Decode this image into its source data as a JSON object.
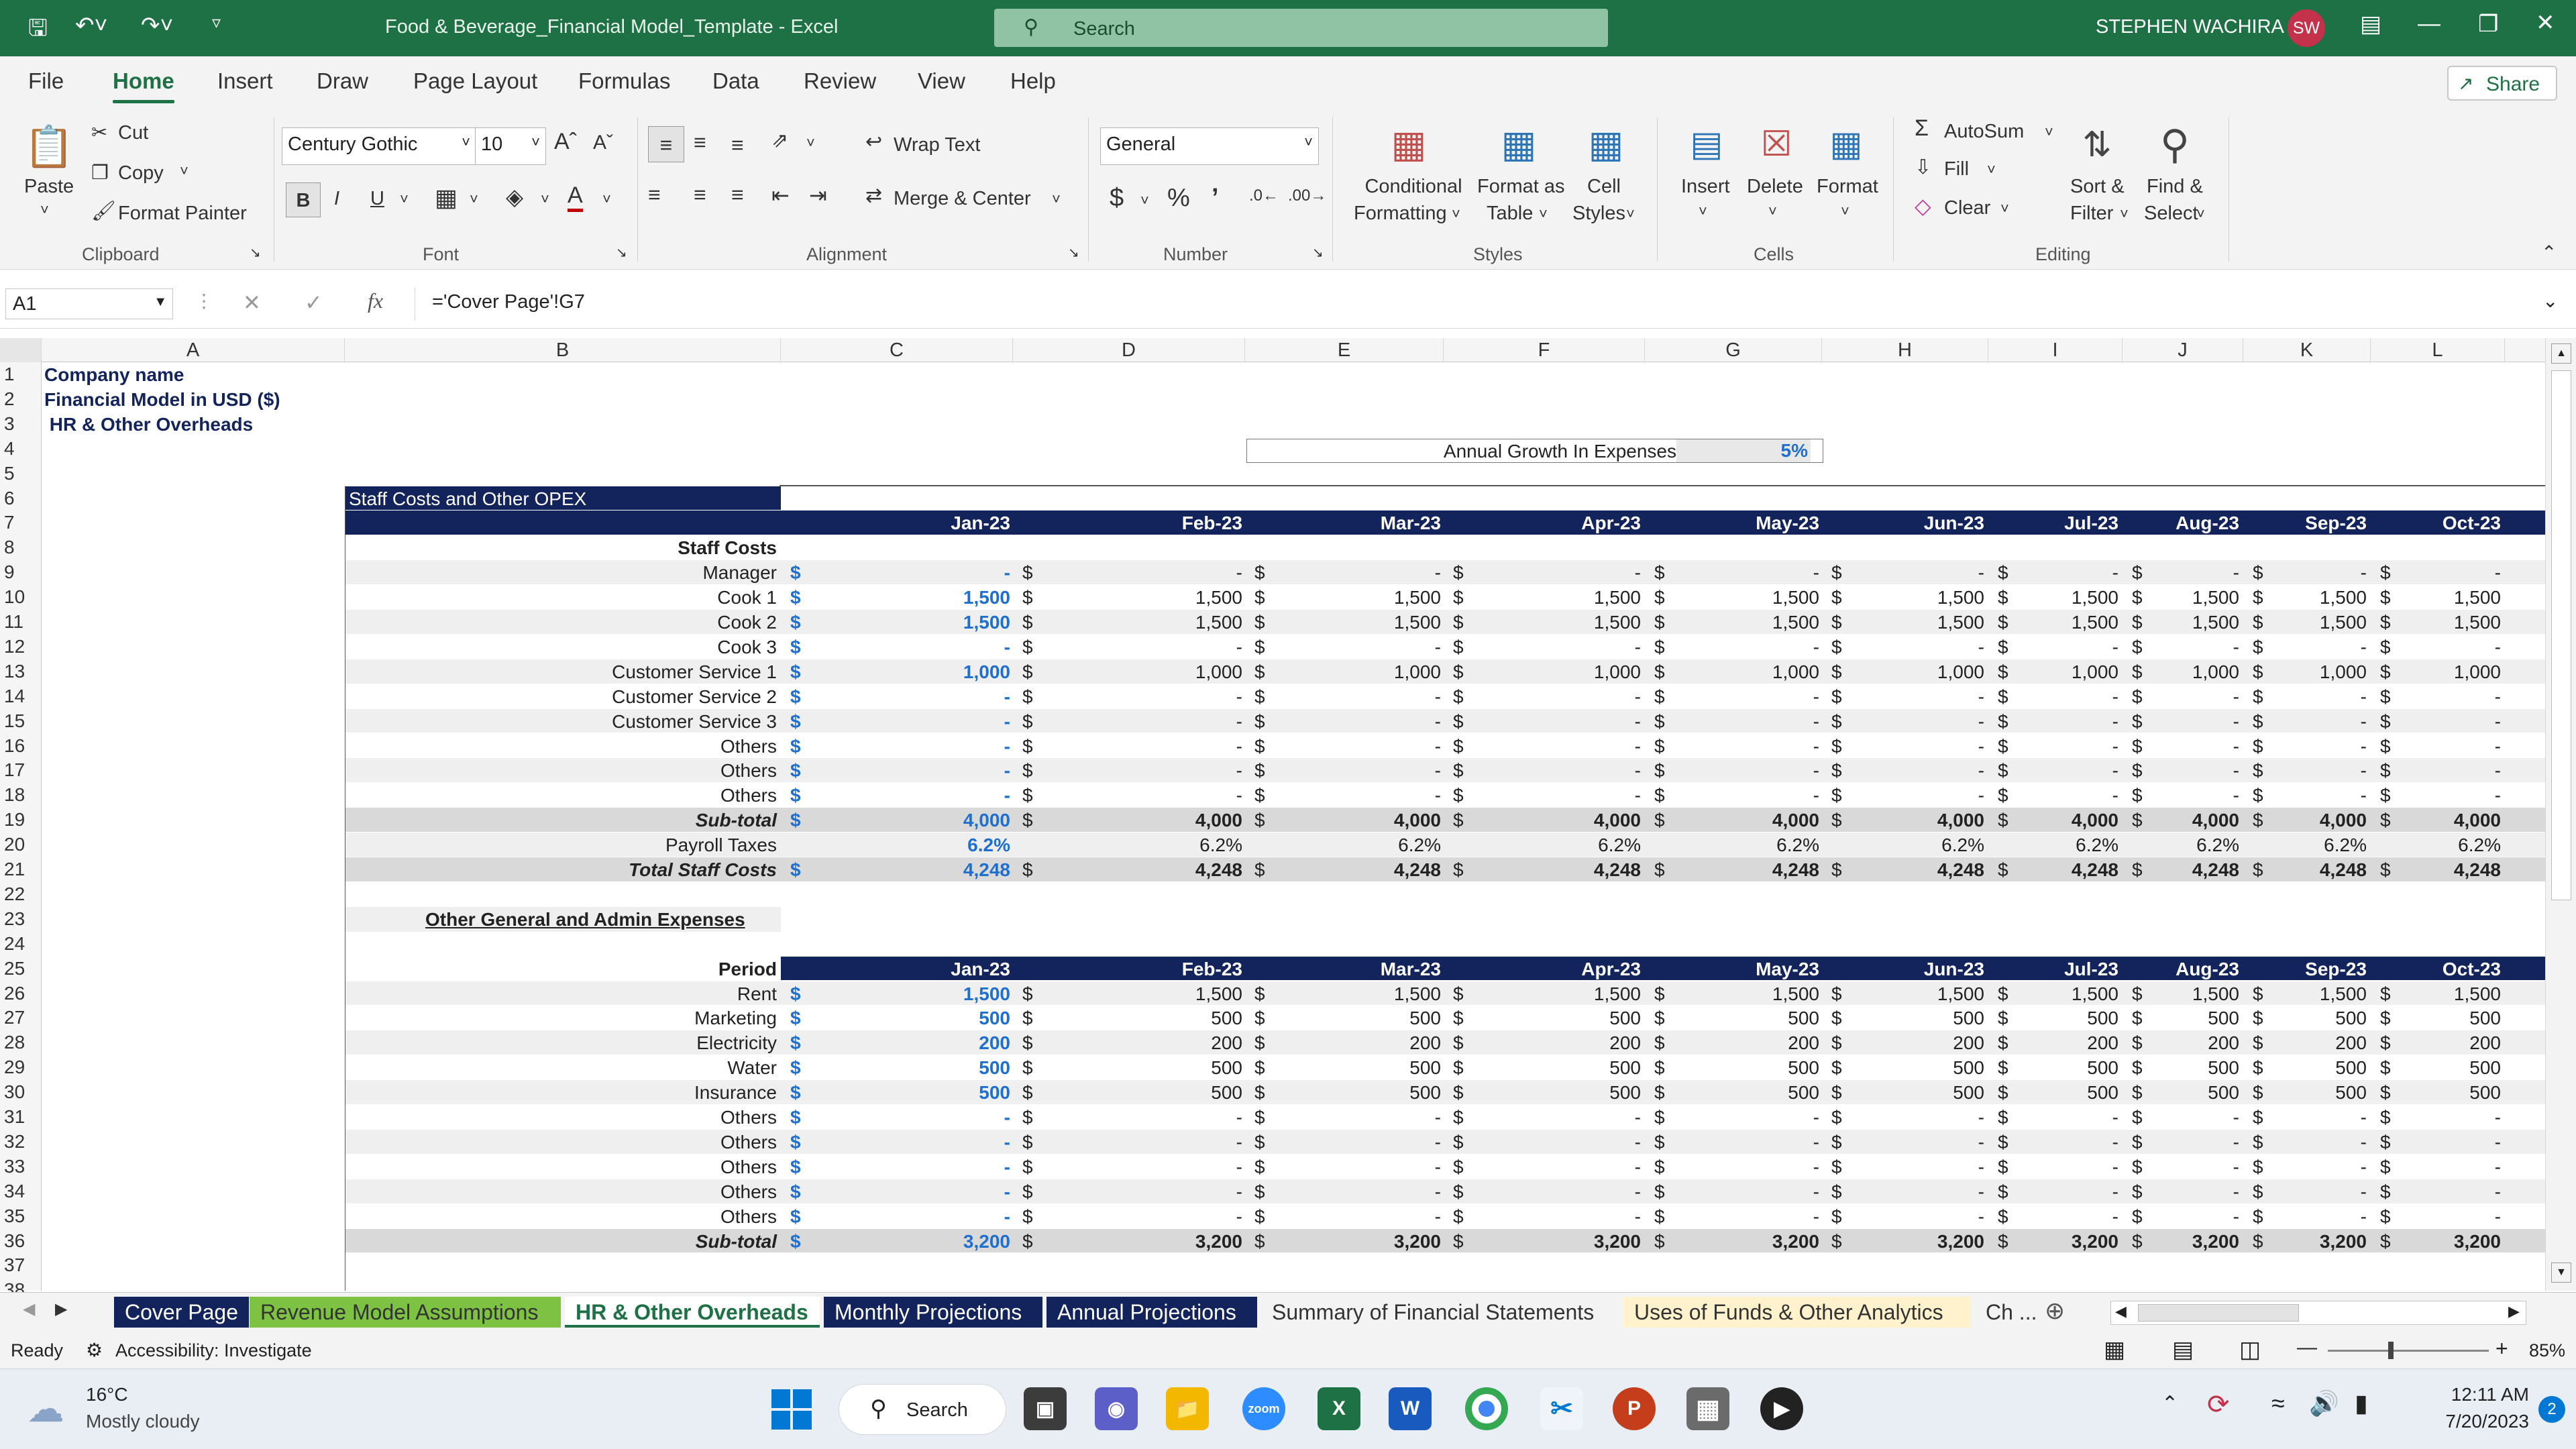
{
  "titlebar": {
    "doc_title": "Food & Beverage_Financial Model_Template  -  Excel",
    "search_placeholder": "Search",
    "user_name": "STEPHEN WACHIRA",
    "user_initials": "SW"
  },
  "menu": {
    "tabs": [
      "File",
      "Home",
      "Insert",
      "Draw",
      "Page Layout",
      "Formulas",
      "Data",
      "Review",
      "View",
      "Help"
    ],
    "active": "Home",
    "share": "Share"
  },
  "ribbon": {
    "paste": "Paste",
    "cut": "Cut",
    "copy": "Copy",
    "format_painter": "Format Painter",
    "clipboard": "Clipboard",
    "font_name": "Century Gothic",
    "font_size": "10",
    "font": "Font",
    "wrap_text": "Wrap Text",
    "merge_center": "Merge & Center",
    "alignment": "Alignment",
    "number_format": "General",
    "number": "Number",
    "conditional_formatting": [
      "Conditional",
      "Formatting"
    ],
    "format_as_table": [
      "Format as",
      "Table"
    ],
    "cell_styles": [
      "Cell",
      "Styles"
    ],
    "styles": "Styles",
    "insert": "Insert",
    "delete": "Delete",
    "format": "Format",
    "cells": "Cells",
    "autosum": "AutoSum",
    "fill": "Fill",
    "clear": "Clear",
    "sort_filter": [
      "Sort &",
      "Filter"
    ],
    "find_select": [
      "Find &",
      "Select"
    ],
    "editing": "Editing"
  },
  "formula_bar": {
    "name_box": "A1",
    "formula": "='Cover Page'!G7",
    "fx": "fx"
  },
  "columns": [
    "A",
    "B",
    "C",
    "D",
    "E",
    "F",
    "G",
    "H",
    "I",
    "J",
    "K",
    "L"
  ],
  "rows": [
    "1",
    "2",
    "3",
    "4",
    "5",
    "6",
    "7",
    "8",
    "9",
    "10",
    "11",
    "12",
    "13",
    "14",
    "15",
    "16",
    "17",
    "18",
    "19",
    "20",
    "21",
    "22",
    "23",
    "24",
    "25",
    "26",
    "27",
    "28",
    "29",
    "30",
    "31",
    "32",
    "33",
    "34",
    "35",
    "36",
    "37",
    "38"
  ],
  "sheet": {
    "company": "Company name",
    "model": "Financial  Model in USD ($)",
    "section": " HR & Other Overheads",
    "growth_label": "Annual Growth In Expenses",
    "growth_value": "5%",
    "staff_header": "Staff Costs and Other OPEX",
    "staff_costs": "Staff Costs",
    "other_header": "Other General and Admin Expenses",
    "period": "Period",
    "months": [
      "Jan-23",
      "Feb-23",
      "Mar-23",
      "Apr-23",
      "May-23",
      "Jun-23",
      "Jul-23",
      "Aug-23",
      "Sep-23",
      "Oct-23"
    ],
    "staff_rows": [
      {
        "label": "Manager",
        "values": [
          "-",
          "-",
          "-",
          "-",
          "-",
          "-",
          "-",
          "-",
          "-",
          "-"
        ]
      },
      {
        "label": "Cook 1",
        "values": [
          "1,500",
          "1,500",
          "1,500",
          "1,500",
          "1,500",
          "1,500",
          "1,500",
          "1,500",
          "1,500",
          "1,500"
        ]
      },
      {
        "label": "Cook 2",
        "values": [
          "1,500",
          "1,500",
          "1,500",
          "1,500",
          "1,500",
          "1,500",
          "1,500",
          "1,500",
          "1,500",
          "1,500"
        ]
      },
      {
        "label": "Cook 3",
        "values": [
          "-",
          "-",
          "-",
          "-",
          "-",
          "-",
          "-",
          "-",
          "-",
          "-"
        ]
      },
      {
        "label": "Customer Service 1",
        "values": [
          "1,000",
          "1,000",
          "1,000",
          "1,000",
          "1,000",
          "1,000",
          "1,000",
          "1,000",
          "1,000",
          "1,000"
        ]
      },
      {
        "label": "Customer Service 2",
        "values": [
          "-",
          "-",
          "-",
          "-",
          "-",
          "-",
          "-",
          "-",
          "-",
          "-"
        ]
      },
      {
        "label": "Customer Service 3",
        "values": [
          "-",
          "-",
          "-",
          "-",
          "-",
          "-",
          "-",
          "-",
          "-",
          "-"
        ]
      },
      {
        "label": "Others",
        "values": [
          "-",
          "-",
          "-",
          "-",
          "-",
          "-",
          "-",
          "-",
          "-",
          "-"
        ]
      },
      {
        "label": "Others",
        "values": [
          "-",
          "-",
          "-",
          "-",
          "-",
          "-",
          "-",
          "-",
          "-",
          "-"
        ]
      },
      {
        "label": "Others",
        "values": [
          "-",
          "-",
          "-",
          "-",
          "-",
          "-",
          "-",
          "-",
          "-",
          "-"
        ]
      }
    ],
    "staff_subtotal": {
      "label": "Sub-total",
      "values": [
        "4,000",
        "4,000",
        "4,000",
        "4,000",
        "4,000",
        "4,000",
        "4,000",
        "4,000",
        "4,000",
        "4,000"
      ]
    },
    "payroll_taxes": {
      "label": "Payroll Taxes",
      "values": [
        "6.2%",
        "6.2%",
        "6.2%",
        "6.2%",
        "6.2%",
        "6.2%",
        "6.2%",
        "6.2%",
        "6.2%",
        "6.2%"
      ]
    },
    "total_staff": {
      "label": "Total Staff Costs",
      "values": [
        "4,248",
        "4,248",
        "4,248",
        "4,248",
        "4,248",
        "4,248",
        "4,248",
        "4,248",
        "4,248",
        "4,248"
      ]
    },
    "other_rows": [
      {
        "label": "Rent",
        "values": [
          "1,500",
          "1,500",
          "1,500",
          "1,500",
          "1,500",
          "1,500",
          "1,500",
          "1,500",
          "1,500",
          "1,500"
        ]
      },
      {
        "label": "Marketing",
        "values": [
          "500",
          "500",
          "500",
          "500",
          "500",
          "500",
          "500",
          "500",
          "500",
          "500"
        ]
      },
      {
        "label": "Electricity",
        "values": [
          "200",
          "200",
          "200",
          "200",
          "200",
          "200",
          "200",
          "200",
          "200",
          "200"
        ]
      },
      {
        "label": "Water",
        "values": [
          "500",
          "500",
          "500",
          "500",
          "500",
          "500",
          "500",
          "500",
          "500",
          "500"
        ]
      },
      {
        "label": "Insurance",
        "values": [
          "500",
          "500",
          "500",
          "500",
          "500",
          "500",
          "500",
          "500",
          "500",
          "500"
        ]
      },
      {
        "label": "Others",
        "values": [
          "-",
          "-",
          "-",
          "-",
          "-",
          "-",
          "-",
          "-",
          "-",
          "-"
        ]
      },
      {
        "label": "Others",
        "values": [
          "-",
          "-",
          "-",
          "-",
          "-",
          "-",
          "-",
          "-",
          "-",
          "-"
        ]
      },
      {
        "label": "Others",
        "values": [
          "-",
          "-",
          "-",
          "-",
          "-",
          "-",
          "-",
          "-",
          "-",
          "-"
        ]
      },
      {
        "label": "Others",
        "values": [
          "-",
          "-",
          "-",
          "-",
          "-",
          "-",
          "-",
          "-",
          "-",
          "-"
        ]
      },
      {
        "label": "Others",
        "values": [
          "-",
          "-",
          "-",
          "-",
          "-",
          "-",
          "-",
          "-",
          "-",
          "-"
        ]
      }
    ],
    "other_subtotal": {
      "label": "Sub-total",
      "values": [
        "3,200",
        "3,200",
        "3,200",
        "3,200",
        "3,200",
        "3,200",
        "3,200",
        "3,200",
        "3,200",
        "3,200"
      ]
    },
    "currency": "$"
  },
  "sheet_tabs": [
    {
      "label": "Cover Page",
      "color": "#13235b"
    },
    {
      "label": "Revenue Model Assumptions",
      "color": "#7dc242"
    },
    {
      "label": "HR & Other Overheads",
      "color": "#ffffff"
    },
    {
      "label": "Monthly Projections",
      "color": "#13235b"
    },
    {
      "label": "Annual Projections",
      "color": "#13235b"
    },
    {
      "label": "Summary of Financial Statements",
      "color": "#f3f3f3"
    },
    {
      "label": "Uses of Funds & Other Analytics",
      "color": "#fff2cc"
    },
    {
      "label": "Ch ...",
      "color": "#f3f3f3"
    }
  ],
  "status": {
    "ready": "Ready",
    "accessibility": "Accessibility: Investigate",
    "zoom": "85%"
  },
  "taskbar": {
    "temp": "16°C",
    "weather": "Mostly cloudy",
    "search": "Search",
    "time": "12:11 AM",
    "date": "7/20/2023",
    "notifications": "2"
  }
}
